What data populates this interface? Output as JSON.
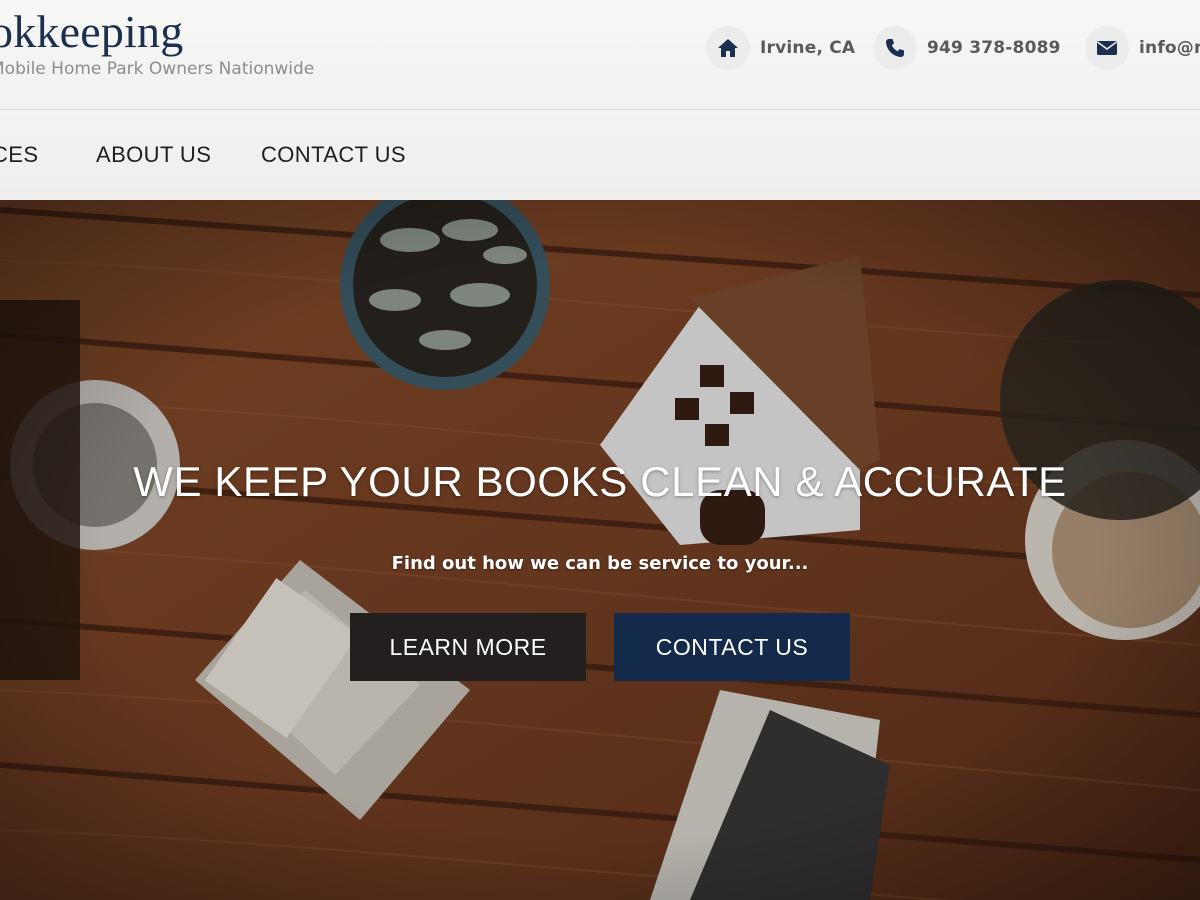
{
  "colors": {
    "brand_navy": "#1b2f4e",
    "button_dark": "#231f1e",
    "button_navy": "#142a4a",
    "header_bg": "#f4f4f3"
  },
  "header": {
    "brand_name": "okkeeping",
    "tagline": "Mobile Home Park Owners Nationwide",
    "contacts": [
      {
        "icon": "home-icon",
        "text": "Irvine, CA"
      },
      {
        "icon": "phone-icon",
        "text": "949 378-8089"
      },
      {
        "icon": "envelope-icon",
        "text": "info@m"
      }
    ]
  },
  "nav": {
    "items": [
      "CES",
      "ABOUT US",
      "CONTACT US"
    ]
  },
  "hero": {
    "title": "WE KEEP YOUR BOOKS CLEAN & ACCURATE",
    "subtitle": "Find out how we can be service to your...",
    "learn_more_label": "LEARN MORE",
    "contact_label": "CONTACT US"
  }
}
